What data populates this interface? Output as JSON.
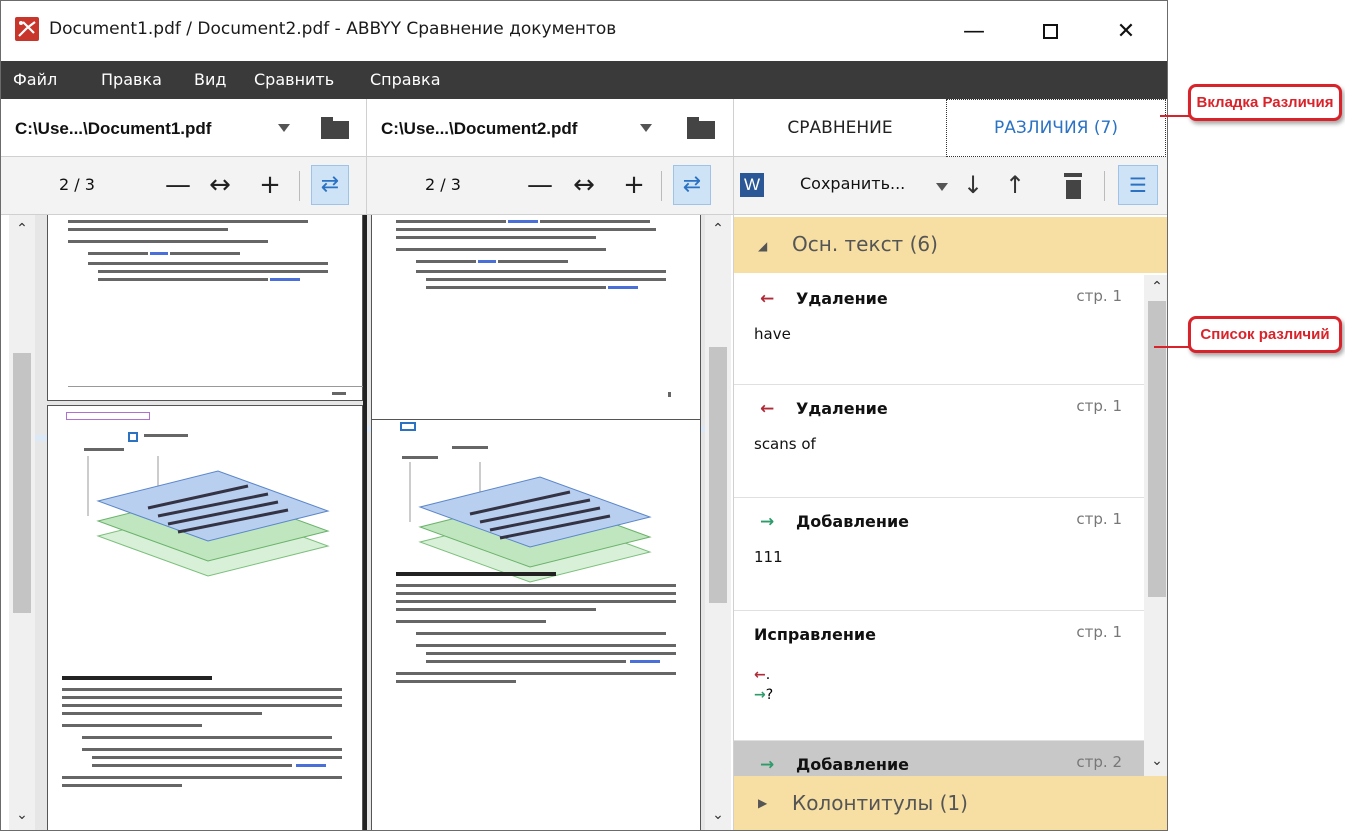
{
  "window": {
    "title": "Document1.pdf / Document2.pdf - ABBYY Сравнение документов",
    "min_icon": "minimize-icon",
    "max_icon": "maximize-icon",
    "close_icon": "close-icon"
  },
  "menu": {
    "items": [
      "Файл",
      "Правка",
      "Вид",
      "Сравнить",
      "Справка"
    ]
  },
  "left_doc": {
    "path": "C:\\Use...\\Document1.pdf",
    "page": "2 / 3"
  },
  "right_doc": {
    "path": "C:\\Use...\\Document2.pdf",
    "page": "2 / 3"
  },
  "panel": {
    "tab_compare": "СРАВНЕНИЕ",
    "tab_diffs": "РАЗЛИЧИЯ (7)",
    "word_icon": "W",
    "save_label": "Сохранить...",
    "group_main": "Осн. текст (6)",
    "group_headers": "Колонтитулы (1)",
    "diffs": [
      {
        "type": "Удаление",
        "page": "стр. 1",
        "text": "have",
        "kind": "deletion"
      },
      {
        "type": "Удаление",
        "page": "стр. 1",
        "text": "scans of",
        "kind": "deletion"
      },
      {
        "type": "Добавление",
        "page": "стр. 1",
        "text": "111",
        "kind": "addition"
      },
      {
        "type": "Исправление",
        "page": "стр. 1",
        "old": ".",
        "new": "?",
        "kind": "correction"
      },
      {
        "type": "Добавление",
        "page": "стр. 2",
        "text": "",
        "kind": "addition"
      }
    ]
  },
  "callouts": {
    "diffs_tab": "Вкладка Различия",
    "diff_list": "Список различий"
  },
  "colors": {
    "accent": "#2b72c3",
    "group_header_bg": "#f7dfa3",
    "deletion": "#b02a37",
    "addition": "#2e9b6a",
    "callout": "#d9232a",
    "menubar": "#3a3a3a"
  }
}
